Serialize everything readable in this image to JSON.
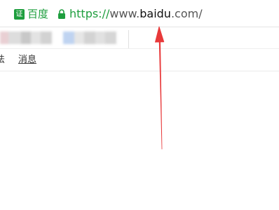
{
  "address_bar": {
    "cert_icon_glyph": "证",
    "site_name": "百度",
    "url_scheme": "https://",
    "url_subdomain": "www.",
    "url_domain": "baidu",
    "url_suffix": ".com/",
    "lock_icon": "lock-icon",
    "secure_color": "#1e9e3e"
  },
  "bookmarks_bar": {
    "state": "blurred"
  },
  "nav": {
    "partial_label": "法",
    "messages_label": "消息"
  },
  "annotation": {
    "arrow_color": "#e8393a"
  }
}
